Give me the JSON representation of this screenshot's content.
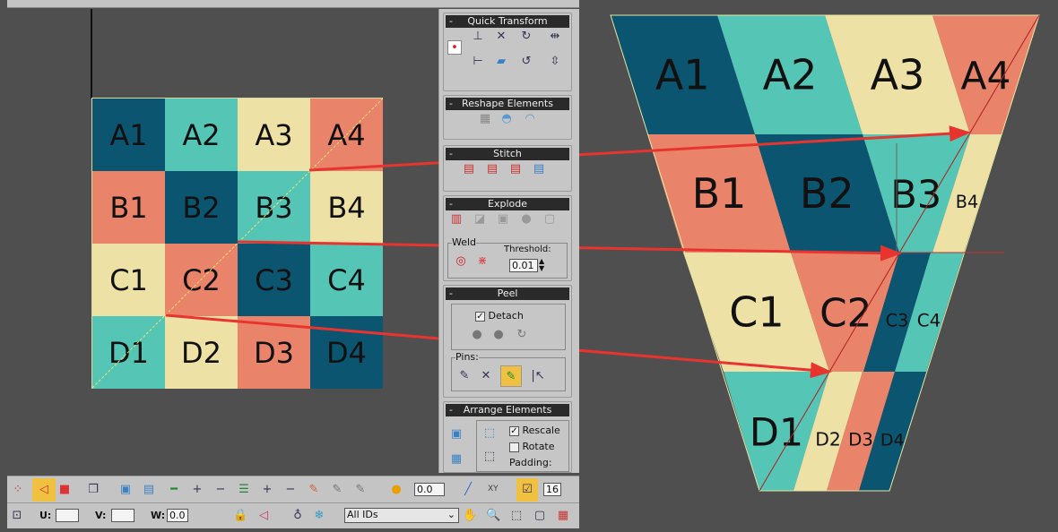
{
  "colors": {
    "dark": "#0b5570",
    "teal": "#55c5b5",
    "cream": "#ede1a5",
    "salmon": "#e9846b",
    "arrow": "#e8342e",
    "highlight": "#f0c040"
  },
  "uv_grid": {
    "rows": [
      [
        {
          "label": "A1",
          "color": "dark"
        },
        {
          "label": "A2",
          "color": "teal"
        },
        {
          "label": "A3",
          "color": "cream"
        },
        {
          "label": "A4",
          "color": "salmon"
        }
      ],
      [
        {
          "label": "B1",
          "color": "salmon"
        },
        {
          "label": "B2",
          "color": "dark"
        },
        {
          "label": "B3",
          "color": "teal"
        },
        {
          "label": "B4",
          "color": "cream"
        }
      ],
      [
        {
          "label": "C1",
          "color": "cream"
        },
        {
          "label": "C2",
          "color": "salmon"
        },
        {
          "label": "C3",
          "color": "dark"
        },
        {
          "label": "C4",
          "color": "teal"
        }
      ],
      [
        {
          "label": "D1",
          "color": "teal"
        },
        {
          "label": "D2",
          "color": "cream"
        },
        {
          "label": "D3",
          "color": "salmon"
        },
        {
          "label": "D4",
          "color": "dark"
        }
      ]
    ]
  },
  "panel": {
    "quick_transform": "Quick Transform",
    "reshape": "Reshape Elements",
    "stitch": "Stitch",
    "explode": "Explode",
    "weld": "Weld",
    "threshold_label": "Threshold:",
    "threshold": "0.01",
    "peel": "Peel",
    "detach": "Detach",
    "pins": "Pins:",
    "arrange": "Arrange Elements",
    "rescale": "Rescale",
    "rotate": "Rotate",
    "padding": "Padding:",
    "collapse": "-"
  },
  "toolbar": {
    "angle": "0.0",
    "xy": "XY",
    "snap": "16",
    "u_label": "U:",
    "v_label": "V:",
    "w_label": "W:",
    "w_value": "0.0",
    "ids": "All IDs"
  }
}
